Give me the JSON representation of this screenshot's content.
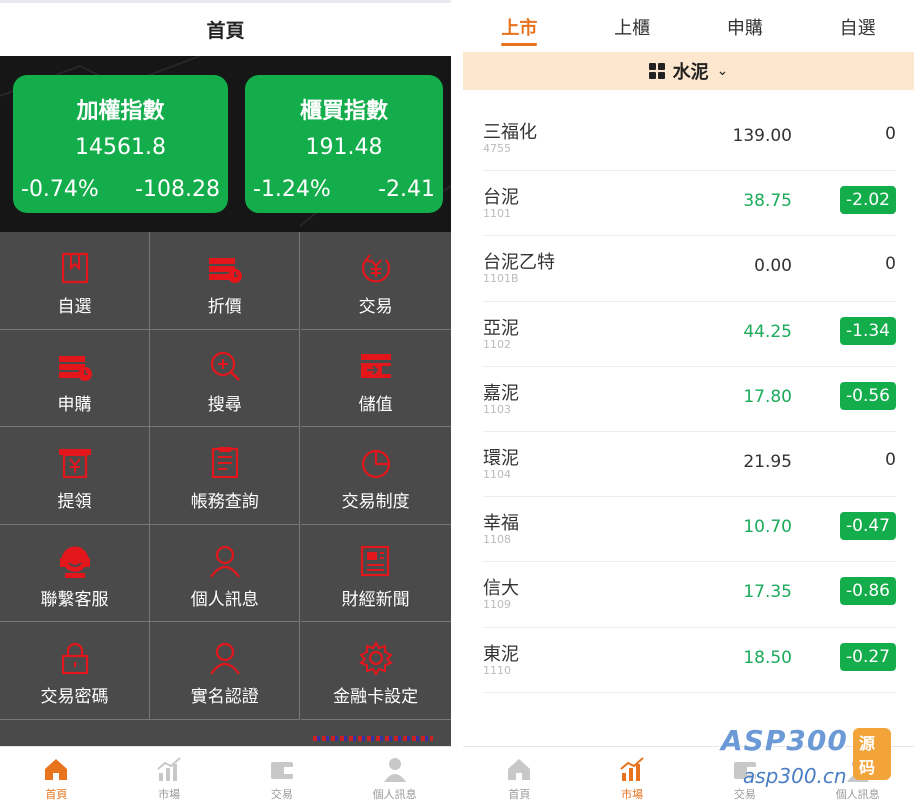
{
  "left": {
    "title": "首頁",
    "indices": [
      {
        "name": "加權指數",
        "value": "14561.8",
        "pct": "-0.74%",
        "change": "-108.28"
      },
      {
        "name": "櫃買指數",
        "value": "191.48",
        "pct": "-1.24%",
        "change": "-2.41"
      }
    ],
    "menu": [
      {
        "label": "自選",
        "icon": "bookmark-icon"
      },
      {
        "label": "折價",
        "icon": "discount-icon"
      },
      {
        "label": "交易",
        "icon": "trade-icon"
      },
      {
        "label": "申購",
        "icon": "subscribe-icon"
      },
      {
        "label": "搜尋",
        "icon": "search-icon"
      },
      {
        "label": "儲值",
        "icon": "wallet-icon"
      },
      {
        "label": "提領",
        "icon": "withdraw-icon"
      },
      {
        "label": "帳務查詢",
        "icon": "ledger-icon"
      },
      {
        "label": "交易制度",
        "icon": "pie-icon"
      },
      {
        "label": "聯繫客服",
        "icon": "headset-icon"
      },
      {
        "label": "個人訊息",
        "icon": "user-icon"
      },
      {
        "label": "財經新聞",
        "icon": "news-icon"
      },
      {
        "label": "交易密碼",
        "icon": "lock-icon"
      },
      {
        "label": "實名認證",
        "icon": "verify-user-icon"
      },
      {
        "label": "金融卡設定",
        "icon": "gear-icon"
      }
    ],
    "tabbar": [
      {
        "label": "首頁",
        "icon": "home-icon",
        "active": true
      },
      {
        "label": "市場",
        "icon": "chart-icon",
        "active": false
      },
      {
        "label": "交易",
        "icon": "wallet-icon",
        "active": false
      },
      {
        "label": "個人訊息",
        "icon": "user-icon",
        "active": false
      }
    ]
  },
  "right": {
    "tabs": [
      "上市",
      "上櫃",
      "申購",
      "自選"
    ],
    "category": "水泥",
    "stocks": [
      {
        "name": "三福化",
        "code": "4755",
        "price": "139.00",
        "change": "0",
        "down": false
      },
      {
        "name": "台泥",
        "code": "1101",
        "price": "38.75",
        "change": "-2.02",
        "down": true
      },
      {
        "name": "台泥乙特",
        "code": "1101B",
        "price": "0.00",
        "change": "0",
        "down": false
      },
      {
        "name": "亞泥",
        "code": "1102",
        "price": "44.25",
        "change": "-1.34",
        "down": true
      },
      {
        "name": "嘉泥",
        "code": "1103",
        "price": "17.80",
        "change": "-0.56",
        "down": true
      },
      {
        "name": "環泥",
        "code": "1104",
        "price": "21.95",
        "change": "0",
        "down": false
      },
      {
        "name": "幸福",
        "code": "1108",
        "price": "10.70",
        "change": "-0.47",
        "down": true
      },
      {
        "name": "信大",
        "code": "1109",
        "price": "17.35",
        "change": "-0.86",
        "down": true
      },
      {
        "name": "東泥",
        "code": "1110",
        "price": "18.50",
        "change": "-0.27",
        "down": true
      }
    ],
    "tabbar": [
      {
        "label": "首頁",
        "icon": "home-icon",
        "active": false
      },
      {
        "label": "市場",
        "icon": "chart-icon",
        "active": true
      },
      {
        "label": "交易",
        "icon": "wallet-icon",
        "active": false
      },
      {
        "label": "個人訊息",
        "icon": "user-icon",
        "active": false
      }
    ],
    "watermark": {
      "brand": "ASP300",
      "tag": "源码",
      "url": "asp300.cn"
    }
  },
  "colors": {
    "accent": "#e8731d",
    "up_down_green": "#14ad4b",
    "icon_red": "#e3161c",
    "grid_bg": "#4a4a4a"
  }
}
